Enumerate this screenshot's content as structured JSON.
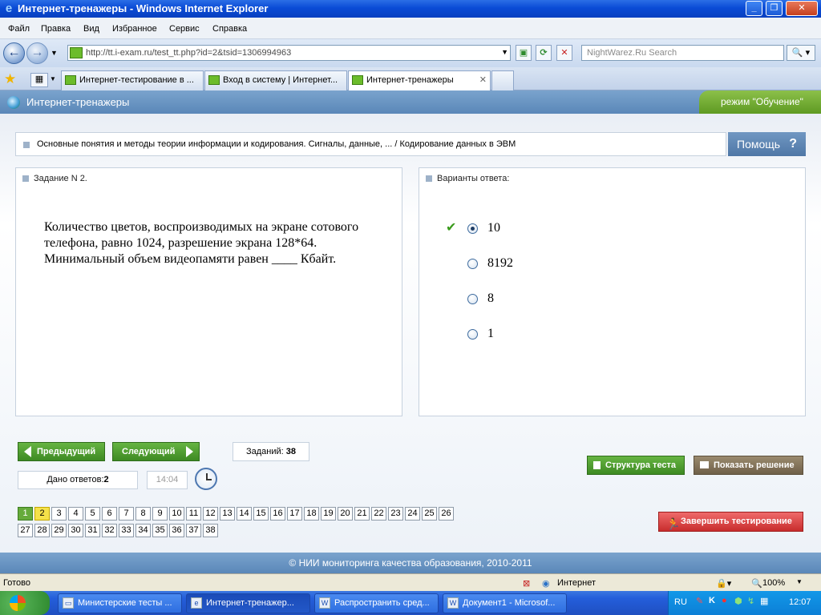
{
  "window": {
    "title": "Интернет-тренажеры - Windows Internet Explorer"
  },
  "menu": [
    "Файл",
    "Правка",
    "Вид",
    "Избранное",
    "Сервис",
    "Справка"
  ],
  "address": {
    "url": "http://tt.i-exam.ru/test_tt.php?id=2&tsid=1306994963"
  },
  "search": {
    "placeholder": "NightWarez.Ru Search"
  },
  "tabs": [
    {
      "label": "Интернет-тестирование в ..."
    },
    {
      "label": "Вход в систему | Интернет..."
    },
    {
      "label": "Интернет-тренажеры"
    }
  ],
  "page": {
    "header_title": "Интернет-тренажеры",
    "mode": "режим \"Обучение\"",
    "breadcrumb": "Основные понятия и методы теории информации и кодирования. Сигналы, данные, ... / Кодирование данных в ЭВМ",
    "help_label": "Помощь",
    "help_symbol": "?",
    "task_heading": "Задание N 2.",
    "question": "Количество цветов, воспроизводимых на экране сотового телефона, равно 1024, разрешение экрана 128*64. Минимальный объем видеопамяти равен ____ Кбайт.",
    "answers_heading": "Варианты ответа:",
    "answers": [
      {
        "value": "10",
        "selected": true,
        "correct": true
      },
      {
        "value": "8192",
        "selected": false,
        "correct": false
      },
      {
        "value": "8",
        "selected": false,
        "correct": false
      },
      {
        "value": "1",
        "selected": false,
        "correct": false
      }
    ],
    "prev_label": "Предыдущий",
    "next_label": "Следующий",
    "tasks_label": "Заданий:",
    "tasks_count": "38",
    "answered_label": "Дано ответов:",
    "answered_count": "2",
    "timer": "14:04",
    "structure_label": "Структура теста",
    "show_solution_label": "Показать решение",
    "finish_label": "Завершить тестирование",
    "pages_row1": [
      "1",
      "2",
      "3",
      "4",
      "5",
      "6",
      "7",
      "8",
      "9",
      "10",
      "11",
      "12",
      "13",
      "14",
      "15",
      "16",
      "17",
      "18",
      "19",
      "20",
      "21",
      "22",
      "23",
      "24",
      "25",
      "26"
    ],
    "pages_row2": [
      "27",
      "28",
      "29",
      "30",
      "31",
      "32",
      "33",
      "34",
      "35",
      "36",
      "37",
      "38"
    ],
    "current_page": "1",
    "answered_pages": [
      "2"
    ],
    "footer": "© НИИ мониторинга качества образования, 2010-2011"
  },
  "statusbar": {
    "status": "Готово",
    "zone": "Интернет",
    "zoom": "100%"
  },
  "taskbar": {
    "items": [
      {
        "label": "Министерские тесты ...",
        "icon": "folder-icon"
      },
      {
        "label": "Интернет-тренажер...",
        "icon": "ie-icon"
      },
      {
        "label": "Распространить сред...",
        "icon": "word-icon"
      },
      {
        "label": "Документ1 - Microsof...",
        "icon": "word-icon"
      }
    ],
    "lang": "RU",
    "time": "12:07"
  }
}
